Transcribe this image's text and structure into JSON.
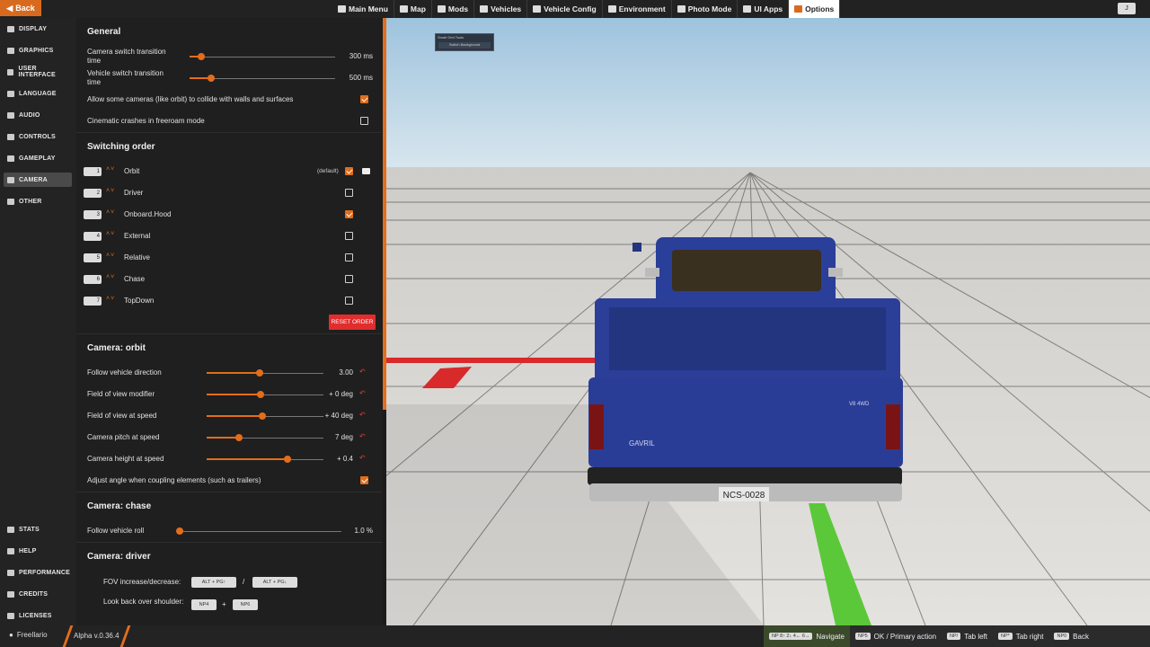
{
  "topbar": {
    "back_label": "Back",
    "nav": [
      {
        "label": "Main Menu",
        "icon": "main-menu-icon"
      },
      {
        "label": "Map",
        "icon": "map-icon"
      },
      {
        "label": "Mods",
        "icon": "mods-icon"
      },
      {
        "label": "Vehicles",
        "icon": "vehicles-icon"
      },
      {
        "label": "Vehicle Config",
        "icon": "vehicle-config-icon"
      },
      {
        "label": "Environment",
        "icon": "environment-icon"
      },
      {
        "label": "Photo Mode",
        "icon": "camera-icon"
      },
      {
        "label": "UI Apps",
        "icon": "ui-apps-icon"
      },
      {
        "label": "Options",
        "icon": "options-icon",
        "active": true
      }
    ],
    "right_key": "J"
  },
  "sidebar": {
    "top_items": [
      {
        "label": "DISPLAY",
        "icon": "display-icon"
      },
      {
        "label": "GRAPHICS",
        "icon": "graphics-icon"
      },
      {
        "label": "USER INTERFACE",
        "icon": "user-interface-icon"
      },
      {
        "label": "LANGUAGE",
        "icon": "language-icon"
      },
      {
        "label": "AUDIO",
        "icon": "audio-icon"
      },
      {
        "label": "CONTROLS",
        "icon": "controls-icon"
      },
      {
        "label": "GAMEPLAY",
        "icon": "gameplay-icon"
      },
      {
        "label": "CAMERA",
        "icon": "camera-icon",
        "active": true
      },
      {
        "label": "OTHER",
        "icon": "other-icon"
      }
    ],
    "bottom_items": [
      {
        "label": "STATS",
        "icon": "stats-icon"
      },
      {
        "label": "HELP",
        "icon": "help-icon"
      },
      {
        "label": "PERFORMANCE",
        "icon": "performance-icon"
      },
      {
        "label": "CREDITS",
        "icon": "credits-icon"
      },
      {
        "label": "LICENSES",
        "icon": "licenses-icon"
      }
    ]
  },
  "general": {
    "title": "General",
    "camera_switch_label": "Camera switch transition time",
    "camera_switch_value": "300 ms",
    "camera_switch_level": 0.08,
    "vehicle_switch_label": "Vehicle switch transition time",
    "vehicle_switch_value": "500 ms",
    "vehicle_switch_level": 0.15,
    "collide_label": "Allow some cameras (like orbit) to collide with walls and surfaces",
    "collide_checked": true,
    "cinematic_label": "Cinematic crashes in freeroam mode",
    "cinematic_checked": false
  },
  "switching_order": {
    "title": "Switching order",
    "default_label": "(default)",
    "reset_label": "RESET ORDER",
    "items": [
      {
        "num": "1",
        "name": "Orbit",
        "checked": true
      },
      {
        "num": "2",
        "name": "Driver",
        "checked": false
      },
      {
        "num": "3",
        "name": "Onboard.Hood",
        "checked": true
      },
      {
        "num": "4",
        "name": "External",
        "checked": false
      },
      {
        "num": "5",
        "name": "Relative",
        "checked": false
      },
      {
        "num": "6",
        "name": "Chase",
        "checked": false
      },
      {
        "num": "7",
        "name": "TopDown",
        "checked": false
      }
    ]
  },
  "orbit": {
    "title": "Camera: orbit",
    "sliders": [
      {
        "label": "Follow vehicle direction",
        "value": "3.00",
        "level": 0.45
      },
      {
        "label": "Field of view modifier",
        "value": "+ 0 deg",
        "level": 0.46
      },
      {
        "label": "Field of view at speed",
        "value": "+ 40 deg",
        "level": 0.48
      },
      {
        "label": "Camera pitch at speed",
        "value": "7 deg",
        "level": 0.28
      },
      {
        "label": "Camera height at speed",
        "value": "+ 0.4",
        "level": 0.69
      }
    ],
    "adjust_label": "Adjust angle when coupling elements (such as trailers)",
    "adjust_checked": true
  },
  "chase": {
    "title": "Camera: chase",
    "roll_label": "Follow vehicle roll",
    "roll_value": "1.0 %",
    "roll_level": 0.0
  },
  "driver": {
    "title": "Camera: driver",
    "fov_label": "FOV increase/decrease:",
    "fov_key1": "ALT + PG↑",
    "fov_sep": "/",
    "fov_key2": "ALT + PG↓",
    "look_label": "Look back over shoulder:",
    "look_key1": "NP4",
    "look_sep": "+",
    "look_key2": "NP6"
  },
  "popup": {
    "title": "Small Grid Tools",
    "button": "Switch Background"
  },
  "bottombar": {
    "user": "FreeIlario",
    "version": "Alpha v.0.36.4",
    "hints": [
      {
        "keys": "NP 8↑ 2↓ 4← 6→",
        "label": "Navigate",
        "accent": true
      },
      {
        "keys": "NP5",
        "label": "OK / Primary action"
      },
      {
        "keys": "NP/",
        "label": "Tab left"
      },
      {
        "keys": "NP*",
        "label": "Tab right"
      },
      {
        "keys": "NP0",
        "label": "Back"
      }
    ]
  },
  "scene": {
    "plate": "NCS-0028",
    "brand": "GAVRIL",
    "badge": "V8  4WD"
  },
  "colors": {
    "accent": "#e36d1b",
    "danger": "#e02d2d",
    "truck": "#2a3f9a"
  }
}
